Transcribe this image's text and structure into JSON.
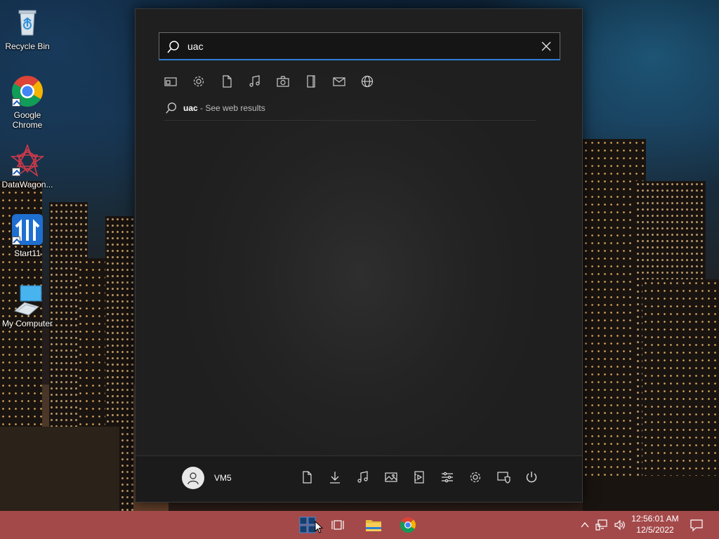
{
  "desktop": {
    "icons": [
      {
        "label": "Recycle Bin"
      },
      {
        "label": "Google Chrome"
      },
      {
        "label": "DataWagon..."
      },
      {
        "label": "Start11"
      },
      {
        "label": "My Computer"
      }
    ]
  },
  "start_menu": {
    "search": {
      "value": "uac",
      "placeholder": ""
    },
    "filters": [
      "apps",
      "settings",
      "documents",
      "music",
      "photos",
      "folders",
      "email",
      "web"
    ],
    "web_result": {
      "query": "uac",
      "suffix": " - See web results"
    },
    "user": {
      "name": "VM5"
    },
    "footer_icons": [
      "documents",
      "downloads",
      "music",
      "pictures",
      "videos",
      "control-panel",
      "settings",
      "security",
      "power"
    ]
  },
  "taskbar": {
    "clock": {
      "time": "12:56:01 AM",
      "date": "12/5/2022"
    },
    "pinned": [
      "start11",
      "task-view",
      "file-explorer",
      "chrome"
    ]
  },
  "colors": {
    "taskbar": "#a4494a",
    "accent": "#2d7fd6",
    "start_bg": "#1f1f1f"
  }
}
